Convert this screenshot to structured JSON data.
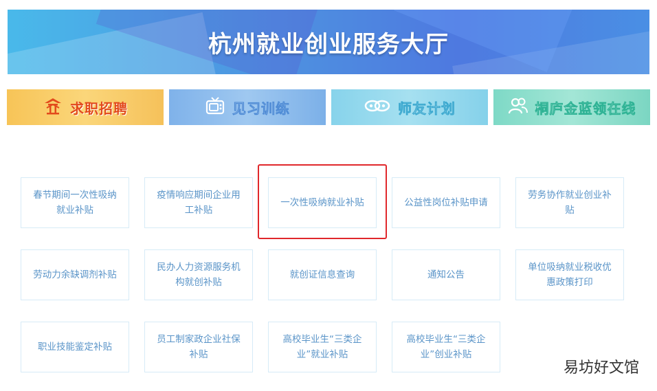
{
  "banner": {
    "title": "杭州就业创业服务大厅"
  },
  "tabs": [
    {
      "label": "求职招聘",
      "icon": "pavilion-icon"
    },
    {
      "label": "见习训练",
      "icon": "tv-icon"
    },
    {
      "label": "师友计划",
      "icon": "chain-link-icon"
    },
    {
      "label": "桐庐金蓝领在线",
      "icon": "people-icon"
    }
  ],
  "services": [
    "春节期间一次性吸纳就业补贴",
    "疫情响应期间企业用工补贴",
    "一次性吸纳就业补贴",
    "公益性岗位补贴申请",
    "劳务协作就业创业补贴",
    "劳动力余缺调剂补贴",
    "民办人力资源服务机构就创补贴",
    "就创证信息查询",
    "通知公告",
    "单位吸纳就业税收优惠政策打印",
    "职业技能鉴定补贴",
    "员工制家政企业社保补贴",
    "高校毕业生“三类企业”就业补贴",
    "高校毕业生“三类企业”创业补贴"
  ],
  "watermark": "易坊好文馆",
  "colors": {
    "banner": "#4e8fe0",
    "card_text": "#5a94c8",
    "card_border": "#d6ebf7",
    "highlight": "#e0272b"
  }
}
